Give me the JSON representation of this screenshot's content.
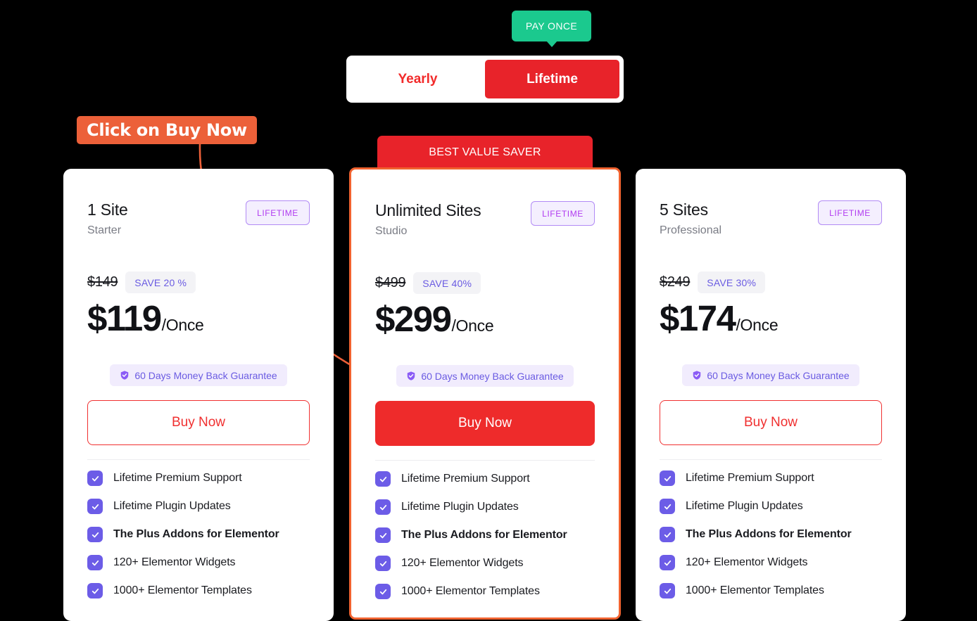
{
  "promo": {
    "pay_once_label": "PAY ONCE"
  },
  "billing_toggle": {
    "options": [
      {
        "label": "Yearly",
        "active": false
      },
      {
        "label": "Lifetime",
        "active": true
      }
    ]
  },
  "annotation": {
    "callout_text": "Click on Buy Now",
    "color": "#EC6039"
  },
  "ribbon": {
    "label": "BEST VALUE SAVER",
    "color": "#E8232A"
  },
  "colors": {
    "accent_red": "#EE2B2B",
    "purple": "#6C5CE7",
    "badge_purple": "#B13BF0",
    "green": "#1BC98E",
    "highlight_border": "#F0622F"
  },
  "plans": [
    {
      "title": "1 Site",
      "subtitle": "Starter",
      "term_badge": "LIFETIME",
      "old_price": "$149",
      "save_label": "SAVE 20 %",
      "price": "$119",
      "period": "/Once",
      "guarantee": "60 Days Money Back Guarantee",
      "cta": "Buy Now",
      "cta_style": "outline",
      "features": [
        {
          "label": "Lifetime Premium Support",
          "bold": false
        },
        {
          "label": "Lifetime Plugin Updates",
          "bold": false
        },
        {
          "label": "The Plus Addons for Elementor",
          "bold": true
        },
        {
          "label": "120+ Elementor Widgets",
          "bold": false
        },
        {
          "label": "1000+ Elementor Templates",
          "bold": false
        }
      ]
    },
    {
      "title": "Unlimited Sites",
      "subtitle": "Studio",
      "term_badge": "LIFETIME",
      "old_price": "$499",
      "save_label": "SAVE 40%",
      "price": "$299",
      "period": "/Once",
      "guarantee": "60 Days Money Back Guarantee",
      "cta": "Buy Now",
      "cta_style": "filled",
      "features": [
        {
          "label": "Lifetime Premium Support",
          "bold": false
        },
        {
          "label": "Lifetime Plugin Updates",
          "bold": false
        },
        {
          "label": "The Plus Addons for Elementor",
          "bold": true
        },
        {
          "label": "120+ Elementor Widgets",
          "bold": false
        },
        {
          "label": "1000+ Elementor Templates",
          "bold": false
        }
      ]
    },
    {
      "title": "5 Sites",
      "subtitle": "Professional",
      "term_badge": "LIFETIME",
      "old_price": "$249",
      "save_label": "SAVE 30%",
      "price": "$174",
      "period": "/Once",
      "guarantee": "60 Days Money Back Guarantee",
      "cta": "Buy Now",
      "cta_style": "outline",
      "features": [
        {
          "label": "Lifetime Premium Support",
          "bold": false
        },
        {
          "label": "Lifetime Plugin Updates",
          "bold": false
        },
        {
          "label": "The Plus Addons for Elementor",
          "bold": true
        },
        {
          "label": "120+ Elementor Widgets",
          "bold": false
        },
        {
          "label": "1000+ Elementor Templates",
          "bold": false
        }
      ]
    }
  ]
}
